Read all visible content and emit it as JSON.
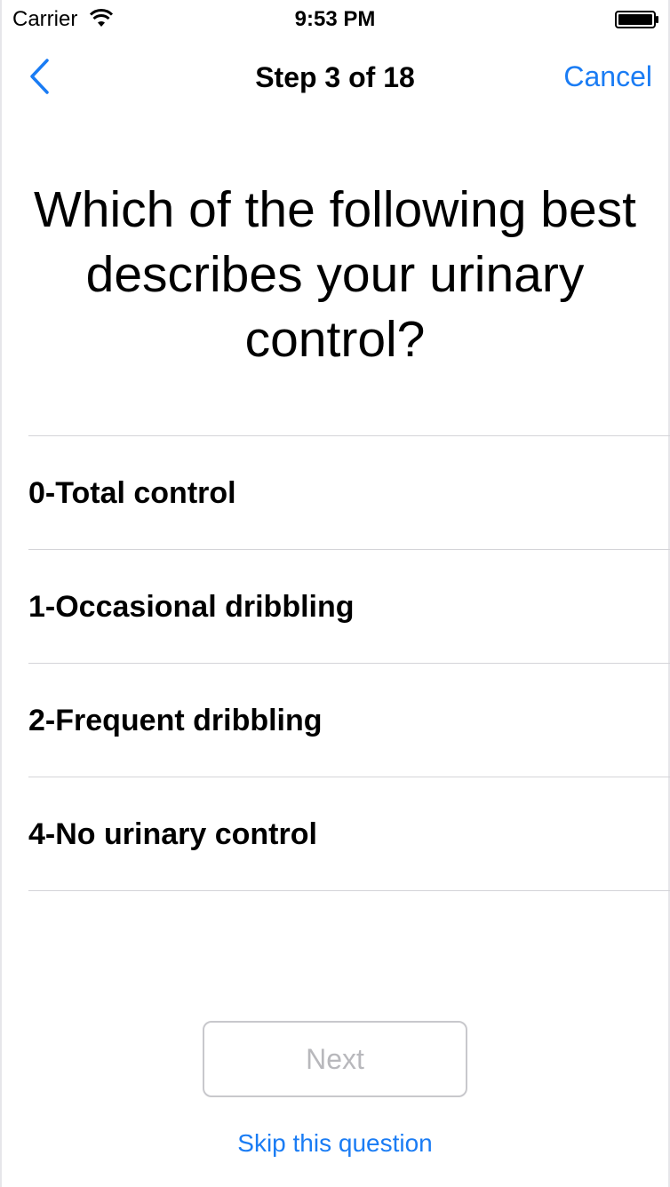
{
  "status_bar": {
    "carrier": "Carrier",
    "time": "9:53 PM",
    "icons": [
      "wifi-icon",
      "battery-icon"
    ]
  },
  "nav": {
    "back_icon": "chevron-left-icon",
    "title": "Step 3 of 18",
    "cancel_label": "Cancel"
  },
  "question": {
    "text": "Which of the following best describes your urinary control?"
  },
  "options": [
    {
      "label": "0-Total control"
    },
    {
      "label": "1-Occasional dribbling"
    },
    {
      "label": "2-Frequent dribbling"
    },
    {
      "label": "4-No urinary control"
    }
  ],
  "footer": {
    "next_label": "Next",
    "skip_label": "Skip this question"
  },
  "colors": {
    "accent": "#1a7cf4",
    "separator": "#d4d4d8",
    "disabled_text": "#b8b8bc"
  }
}
